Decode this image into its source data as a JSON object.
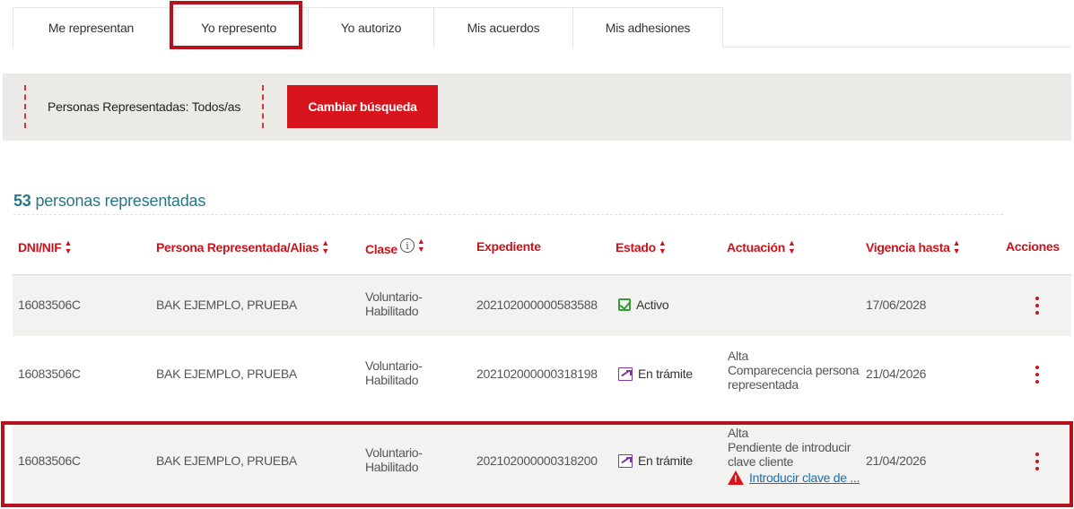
{
  "tabs": [
    {
      "label": "Me representan"
    },
    {
      "label": "Yo represento"
    },
    {
      "label": "Yo autorizo"
    },
    {
      "label": "Mis acuerdos"
    },
    {
      "label": "Mis adhesiones"
    }
  ],
  "filter": {
    "label": "Personas Representadas: Todos/as",
    "button_label": "Cambiar búsqueda"
  },
  "summary": {
    "count": "53",
    "count_suffix": "personas representadas"
  },
  "table": {
    "headers": {
      "dni": "DNI/NIF",
      "persona": "Persona Representada/Alias",
      "clase": "Clase",
      "expediente": "Expediente",
      "estado": "Estado",
      "actuacion": "Actuación",
      "vigencia": "Vigencia hasta",
      "acciones": "Acciones"
    },
    "rows": [
      {
        "dni": "16083506C",
        "persona": "BAK EJEMPLO, PRUEBA",
        "clase": "Voluntario-Habilitado",
        "expediente": "202102000000583588",
        "estado": "Activo",
        "estado_icon": "check-icon",
        "actuacion_line1": "",
        "actuacion_line2": "",
        "vigencia": "17/06/2028"
      },
      {
        "dni": "16083506C",
        "persona": "BAK EJEMPLO, PRUEBA",
        "clase": "Voluntario-Habilitado",
        "expediente": "202102000000318198",
        "estado": "En trámite",
        "estado_icon": "in-progress-icon",
        "actuacion_line1": "Alta",
        "actuacion_line2": "Comparecencia persona representada",
        "vigencia": "21/04/2026"
      },
      {
        "dni": "16083506C",
        "persona": "BAK EJEMPLO, PRUEBA",
        "clase": "Voluntario-Habilitado",
        "expediente": "202102000000318200",
        "estado": "En trámite",
        "estado_icon": "in-progress-icon",
        "actuacion_line1": "Alta",
        "actuacion_line2": "Pendiente de introducir clave cliente",
        "actuacion_link": "Introducir clave de ...",
        "vigencia": "21/04/2026"
      }
    ]
  },
  "colors": {
    "accent_red": "#d7141c",
    "highlight_border": "#b5121b",
    "count_teal": "#2a7485",
    "link_blue": "#1a6fb0"
  }
}
